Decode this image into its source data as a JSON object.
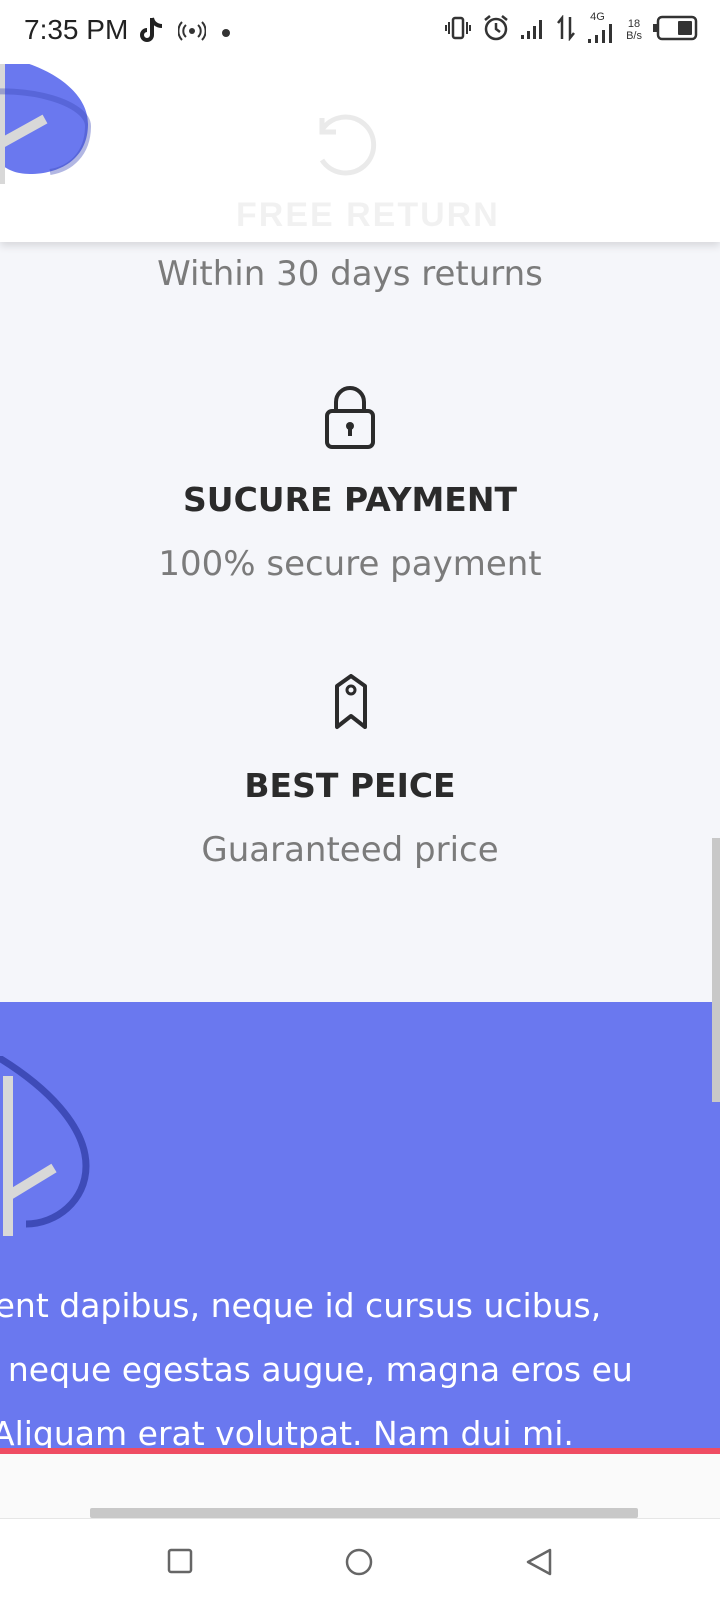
{
  "status_bar": {
    "time": "7:35 PM",
    "network_type": "4G",
    "speed_value": "18",
    "speed_unit": "B/s",
    "icons": [
      "tiktok-icon",
      "hotspot-icon",
      "dot-icon",
      "vibrate-icon",
      "alarm-icon",
      "signal-icon",
      "data-arrows-icon",
      "signal-4g-icon",
      "battery-icon"
    ]
  },
  "header": {
    "logo_icon": "leaf-logo-icon"
  },
  "features": [
    {
      "title": "FREE RETURN",
      "subtitle": "Within 30 days returns",
      "icon": "return-icon"
    },
    {
      "title": "SUCURE PAYMENT",
      "subtitle": "100% secure payment",
      "icon": "lock-icon"
    },
    {
      "title": "BEST PEICE",
      "subtitle": "Guaranteed price",
      "icon": "price-tag-icon"
    }
  ],
  "footer": {
    "logo_icon": "leaf-logo-icon",
    "lines": [
      "Praesent dapibus, neque id cursus ucibus,",
      "tortor neque egestas augue, magna eros eu",
      "erat. Aliquam erat volutpat. Nam dui mi."
    ]
  },
  "nav_bar": {
    "buttons": [
      "recents-button",
      "home-button",
      "back-button"
    ]
  },
  "colors": {
    "accent_blue": "#6a78ef",
    "accent_red": "#ef4d63",
    "page_bg": "#f5f6fa"
  }
}
